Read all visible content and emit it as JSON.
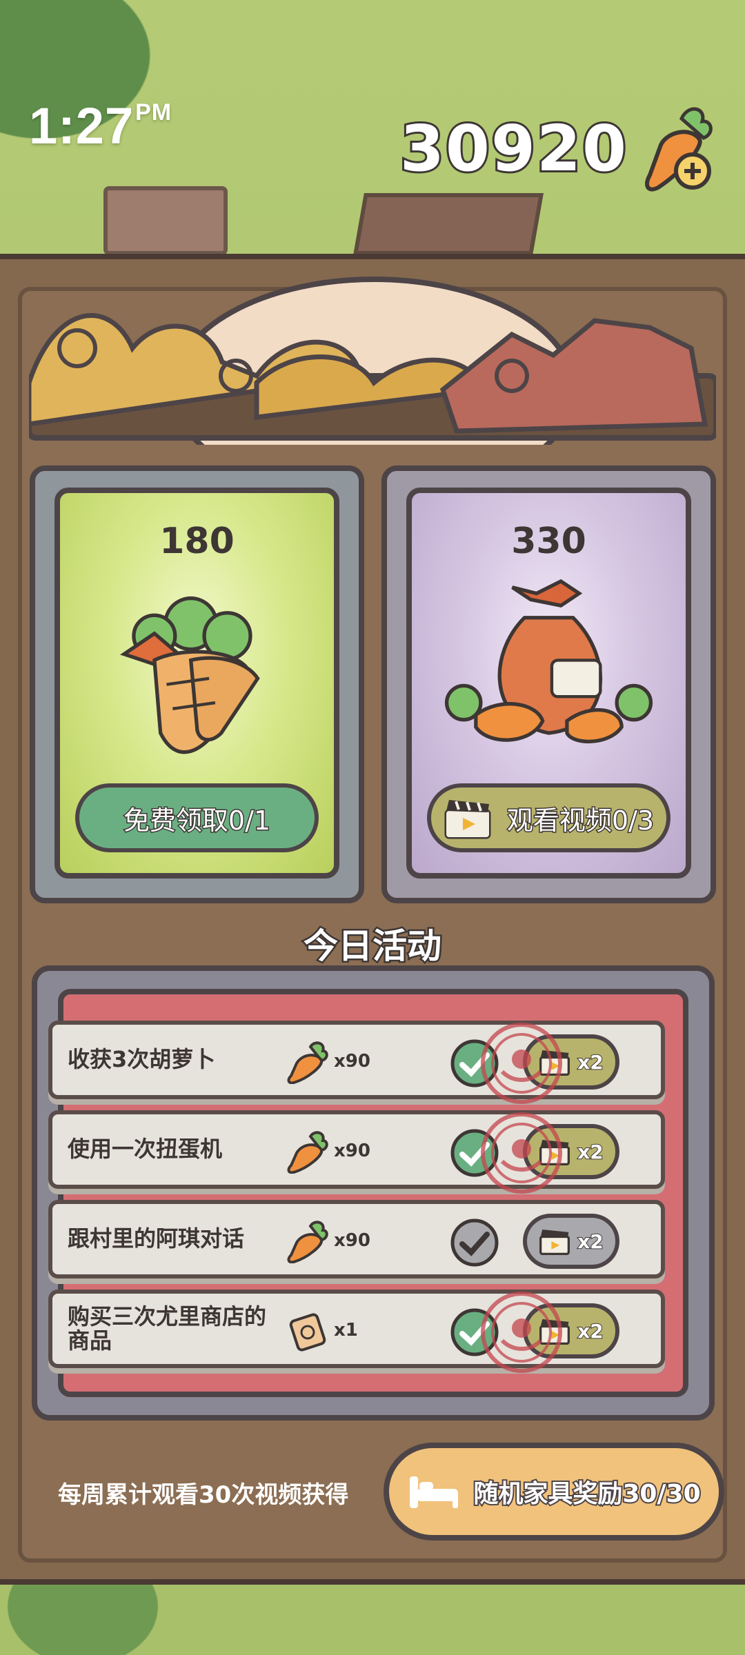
{
  "hud": {
    "time": "1:27",
    "ampm": "PM",
    "carrot_balance": "30920"
  },
  "offers": [
    {
      "amount": "180",
      "button_label": "免费领取0/1",
      "icon": "carrot-bundle-icon"
    },
    {
      "amount": "330",
      "button_label": "观看视频0/3",
      "icon": "carrot-sack-icon"
    }
  ],
  "activities": {
    "title": "今日活动",
    "tasks": [
      {
        "name": "收获3次胡萝卜",
        "reward_icon": "carrot-icon",
        "reward_qty": "x90",
        "completed": true,
        "claimed_stamp": true,
        "double_label": "x2"
      },
      {
        "name": "使用一次扭蛋机",
        "reward_icon": "carrot-icon",
        "reward_qty": "x90",
        "completed": true,
        "claimed_stamp": true,
        "double_label": "x2"
      },
      {
        "name": "跟村里的阿琪对话",
        "reward_icon": "carrot-icon",
        "reward_qty": "x90",
        "completed": false,
        "claimed_stamp": false,
        "double_label": "x2"
      },
      {
        "name": "购买三次尤里商店的商品",
        "reward_icon": "ticket-icon",
        "reward_qty": "x1",
        "completed": true,
        "claimed_stamp": true,
        "double_label": "x2"
      }
    ]
  },
  "weekly": {
    "text": "每周累计观看30次视频获得",
    "button_label": "随机家具奖励30/30"
  },
  "colors": {
    "panel": "#84694f",
    "outline": "#4d4447",
    "free_button": "#6aaf82",
    "video_button": "#b8b36c",
    "activity_bg": "#d46e72",
    "weekly_button": "#f1c27b"
  }
}
